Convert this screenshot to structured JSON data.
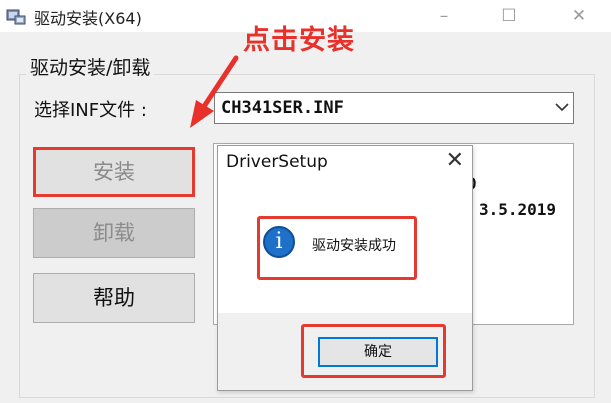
{
  "window": {
    "title": "驱动安装(X64)"
  },
  "group": {
    "title": "驱动安装/卸载"
  },
  "inf": {
    "label": "选择INF文件 :",
    "value": "CH341SER.INF"
  },
  "buttons": {
    "install": "安装",
    "uninstall": "卸载",
    "help": "帮助"
  },
  "info_panel": {
    "line1": "0",
    "line2": "3.5.2019"
  },
  "annotation": {
    "text": "点击安装",
    "color": "#e8312a"
  },
  "dialog": {
    "title": "DriverSetup",
    "message": "驱动安装成功",
    "ok_label": "确定",
    "icon": "info-icon"
  },
  "colors": {
    "highlight": "#e53a2f",
    "info_icon": "#1f70c8",
    "focus": "#0078d7"
  }
}
